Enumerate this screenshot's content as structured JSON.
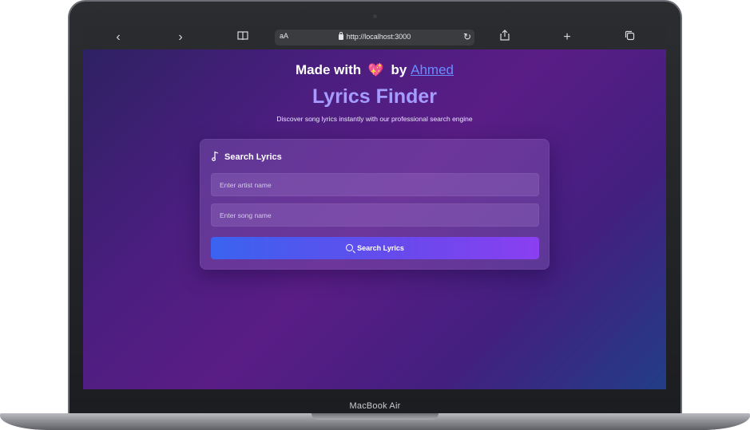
{
  "browser": {
    "back_icon": "chevron-left-icon",
    "forward_icon": "chevron-right-icon",
    "bookmarks_icon": "book-icon",
    "text_size_label": "aA",
    "url": "http://localhost:3000",
    "reload_icon": "reload-icon",
    "share_icon": "share-icon",
    "new_tab_icon": "plus-icon",
    "tabs_icon": "tabs-icon",
    "glyphs": {
      "back": "‹",
      "forward": "›",
      "bookmarks": "📖",
      "reload": "↻",
      "share": "⇪",
      "new_tab": "+",
      "tabs": "⧉"
    }
  },
  "page": {
    "credit_prefix": "Made with",
    "credit_heart": "💖",
    "credit_by": "by",
    "credit_author": "Ahmed",
    "title": "Lyrics Finder",
    "subtitle": "Discover song lyrics instantly with our professional search engine"
  },
  "card": {
    "heading": "Search Lyrics",
    "artist_placeholder": "Enter artist name",
    "song_placeholder": "Enter song name",
    "button_label": "Search Lyrics"
  },
  "device": {
    "label": "MacBook Air"
  },
  "colors": {
    "accent_title": "#a59cff",
    "link": "#6a8cff",
    "button_start": "#3a63f0",
    "button_end": "#8a3ff0"
  }
}
